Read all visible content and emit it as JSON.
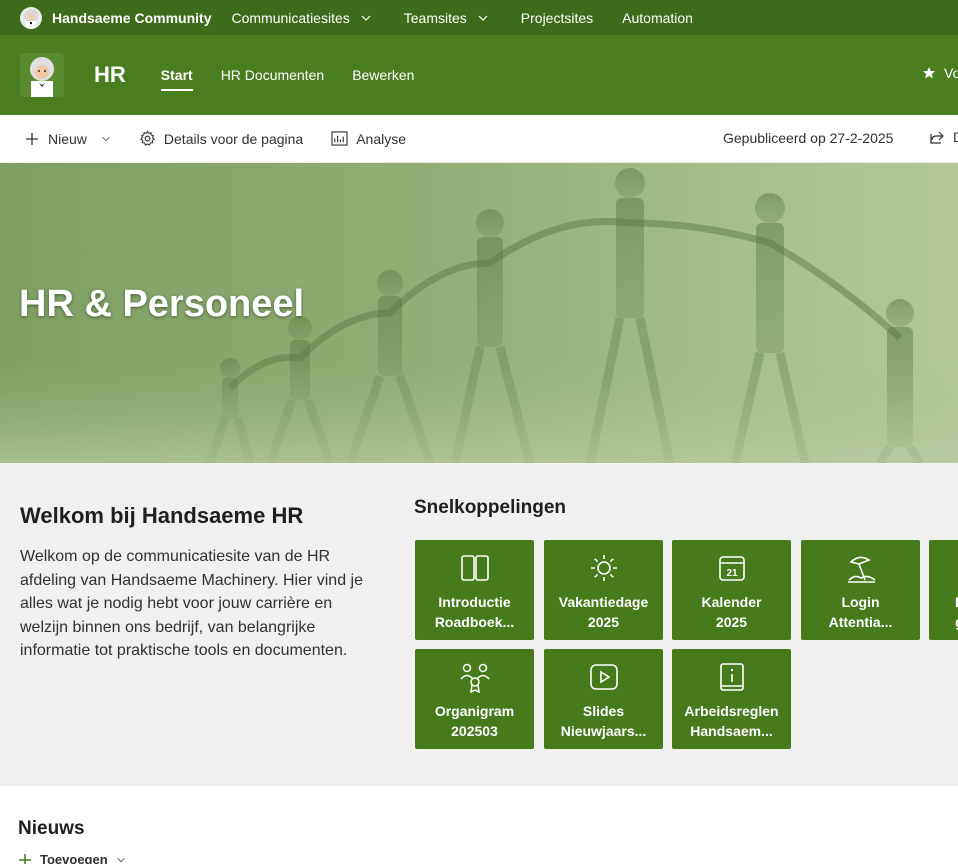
{
  "suitebar": {
    "brand": "Handsaeme Community",
    "nav": [
      {
        "label": "Communicatiesites",
        "has_dropdown": true
      },
      {
        "label": "Teamsites",
        "has_dropdown": true
      },
      {
        "label": "Projectsites",
        "has_dropdown": false
      },
      {
        "label": "Automation",
        "has_dropdown": false
      }
    ]
  },
  "site": {
    "title": "HR",
    "tabs": [
      {
        "label": "Start",
        "active": true
      },
      {
        "label": "HR Documenten",
        "active": false
      },
      {
        "label": "Bewerken",
        "active": false
      }
    ],
    "follow_label": "Vo"
  },
  "commandbar": {
    "new_label": "Nieuw",
    "details_label": "Details voor de pagina",
    "analytics_label": "Analyse",
    "published": "Gepubliceerd op 27-2-2025",
    "share_label": "D"
  },
  "hero": {
    "title": "HR & Personeel"
  },
  "welcome": {
    "title": "Welkom bij Handsaeme HR",
    "text": "Welkom op de communicatiesite van de HR afdeling van Handsaeme Machinery. Hier vind je alles wat je nodig hebt voor jouw carrière en welzijn binnen ons bedrijf, van belangrijke informatie tot praktische tools en documenten."
  },
  "quicklinks": {
    "title": "Snelkoppelingen",
    "tiles": [
      {
        "label": "Introductie\nRoadboek...",
        "icon": "book-open-icon"
      },
      {
        "label": "Vakantiedage\n2025",
        "icon": "sun-icon"
      },
      {
        "label": "Kalender\n2025",
        "icon": "calendar-icon"
      },
      {
        "label": "Login\nAttentia...",
        "icon": "beach-umbrella-icon"
      },
      {
        "label": "I\ngi",
        "icon": "partial-icon"
      },
      {
        "label": "Organigram\n202503",
        "icon": "people-ribbon-icon"
      },
      {
        "label": "Slides\nNieuwjaars...",
        "icon": "video-play-icon"
      },
      {
        "label": "Arbeidsreglen\nHandsaem...",
        "icon": "book-info-icon"
      }
    ],
    "calendar_day": "21"
  },
  "news": {
    "title": "Nieuws",
    "add_label": "Toevoegen"
  },
  "colors": {
    "suitebar": "#3e6b1a",
    "header": "#4a7d1e",
    "tile": "#467a1a"
  }
}
